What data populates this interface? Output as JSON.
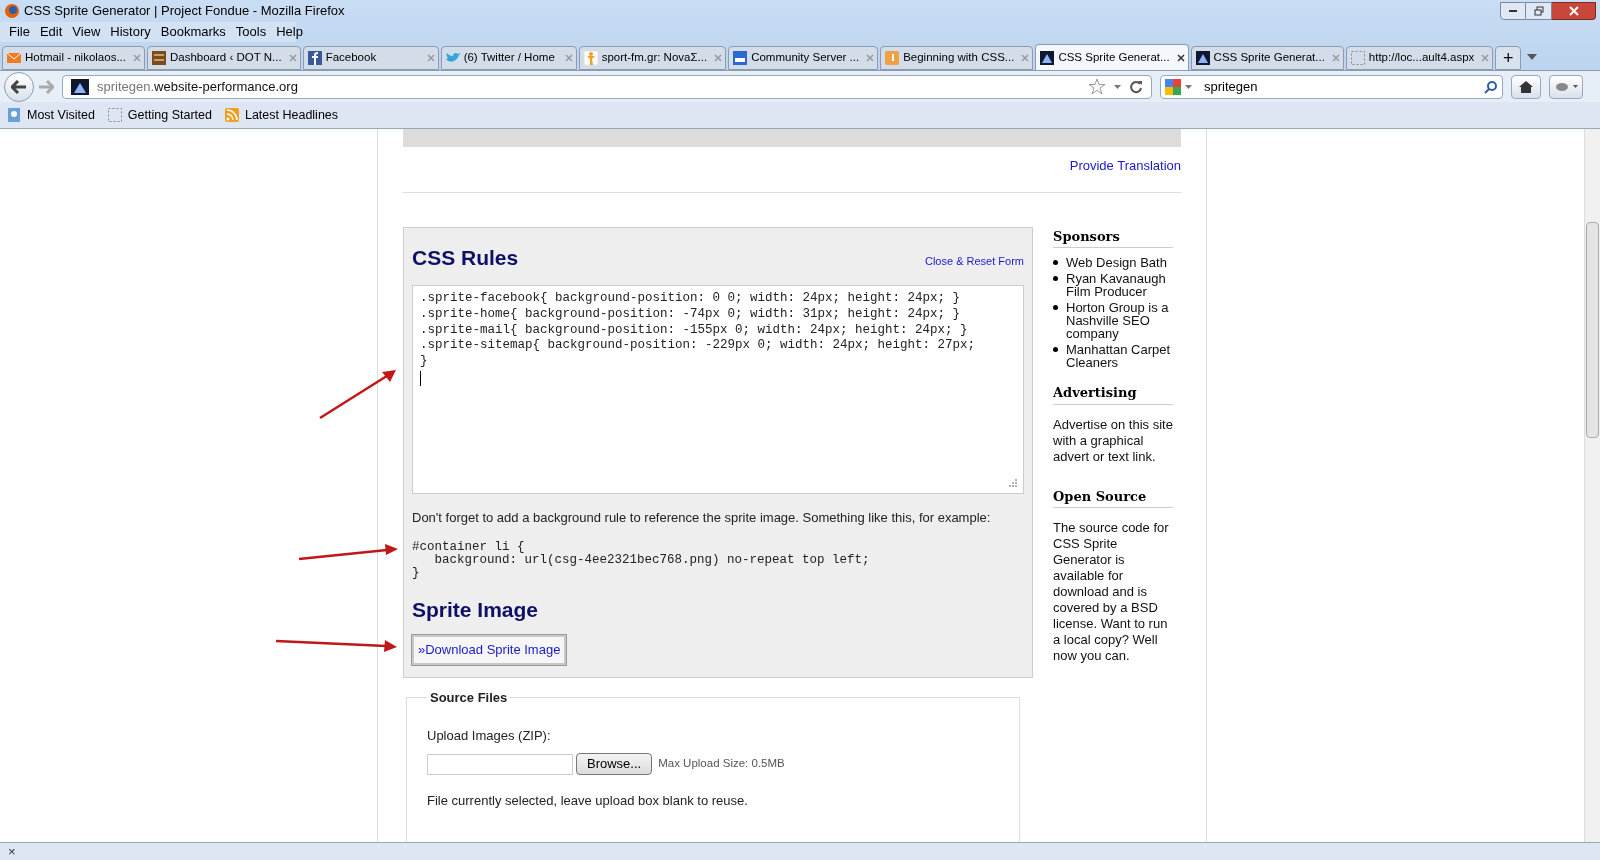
{
  "window": {
    "title": "CSS Sprite Generator | Project Fondue - Mozilla Firefox"
  },
  "menu": [
    "File",
    "Edit",
    "View",
    "History",
    "Bookmarks",
    "Tools",
    "Help"
  ],
  "tabs": [
    {
      "label": "Hotmail - nikolaos...",
      "kind": "mail",
      "selected": false
    },
    {
      "label": "Dashboard ‹ DOT N...",
      "kind": "dashboard",
      "selected": false
    },
    {
      "label": "Facebook",
      "kind": "facebook",
      "selected": false
    },
    {
      "label": "(6) Twitter / Home",
      "kind": "bird",
      "selected": false
    },
    {
      "label": "sport-fm.gr: NovaΣ...",
      "kind": "figure",
      "selected": false
    },
    {
      "label": "Community Server ...",
      "kind": "asp",
      "selected": false
    },
    {
      "label": "Beginning with CSS...",
      "kind": "letter",
      "selected": false
    },
    {
      "label": "CSS Sprite Generat...",
      "kind": "sprite",
      "selected": true
    },
    {
      "label": "CSS Sprite Generat...",
      "kind": "sprite",
      "selected": false
    },
    {
      "label": "http://loc...ault4.aspx",
      "kind": "blank",
      "selected": false
    }
  ],
  "new_tab": "+",
  "address": {
    "host_prefix": "spritegen.",
    "host": "website-performance.org"
  },
  "search": {
    "value": "spritegen"
  },
  "bookmarks": [
    {
      "label": "Most Visited",
      "kind": "page"
    },
    {
      "label": "Getting Started",
      "kind": "blank"
    },
    {
      "label": "Latest Headlines",
      "kind": "feed"
    }
  ],
  "page": {
    "provide_translation": "Provide Translation",
    "css_rules": {
      "title": "CSS Rules",
      "close_link": "Close & Reset Form",
      "code": ".sprite-facebook{ background-position: 0 0; width: 24px; height: 24px; }\n.sprite-home{ background-position: -74px 0; width: 31px; height: 24px; }\n.sprite-mail{ background-position: -155px 0; width: 24px; height: 24px; }\n.sprite-sitemap{ background-position: -229px 0; width: 24px; height: 27px;\n}",
      "note": "Don't forget to add a background rule to reference the sprite image. Something like this, for example:",
      "example": "#container li {\n   background: url(csg-4ee2321bec768.png) no-repeat top left;\n}"
    },
    "sprite_image": {
      "title": "Sprite Image",
      "download": "»Download Sprite Image"
    },
    "source_files": {
      "legend": "Source Files",
      "upload_label": "Upload Images (ZIP):",
      "browse": "Browse...",
      "max_size": "Max Upload Size: 0.5MB",
      "current_note": "File currently selected, leave upload box blank to reuse."
    }
  },
  "sidebar": [
    {
      "heading": "Sponsors",
      "links": [
        "Web Design Bath",
        "Ryan Kavanaugh Film Producer",
        "Horton Group is a Nashville SEO company",
        "Manhattan Carpet Cleaners"
      ]
    },
    {
      "heading": "Advertising",
      "text": "Advertise on this site with a graphical advert or text link."
    },
    {
      "heading": "Open Source",
      "text": "The source code for CSS Sprite Generator is available for download and is covered by a BSD license. Want to run a local copy? Well now you can."
    }
  ],
  "status_bar": {
    "close": "×"
  }
}
